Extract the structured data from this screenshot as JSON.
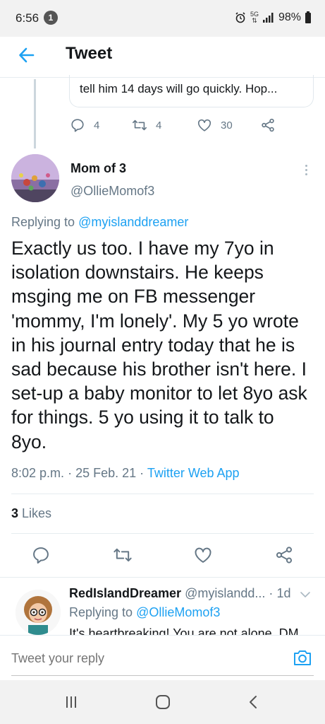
{
  "status_bar": {
    "time": "6:56",
    "notification_count": "1",
    "network_label": "5G",
    "battery": "98%"
  },
  "header": {
    "title": "Tweet"
  },
  "previous_tweet": {
    "text_fragment": "tell him 14 days will go quickly. Hop...",
    "replies": "4",
    "retweets": "4",
    "likes": "30"
  },
  "tweet": {
    "author_name": "Mom of 3",
    "author_handle": "@OllieMomof3",
    "replying_prefix": "Replying to",
    "replying_to": "@myislanddreamer",
    "body": "Exactly us too. I have my 7yo in isolation downstairs. He keeps msging me on FB messenger 'mommy, I'm lonely'. My 5 yo wrote in his journal entry today that he is sad because his brother isn't here. I set-up a baby monitor to let 8yo ask for things. 5 yo using it to talk to 8yo.",
    "time": "8:02 p.m.",
    "date": "25 Feb. 21",
    "app": "Twitter Web App",
    "likes_count": "3",
    "likes_label": "Likes"
  },
  "reply": {
    "author_name": "RedIslandDreamer",
    "author_handle": "@myislandd...",
    "age": "1d",
    "replying_prefix": "Replying to",
    "replying_to": "@OllieMomof3",
    "text": "It's heartbreaking! You are not alone. DM"
  },
  "compose": {
    "placeholder": "Tweet your reply"
  },
  "colors": {
    "accent": "#1da1f2",
    "secondary_text": "#657786",
    "divider": "#e6ecf0"
  }
}
